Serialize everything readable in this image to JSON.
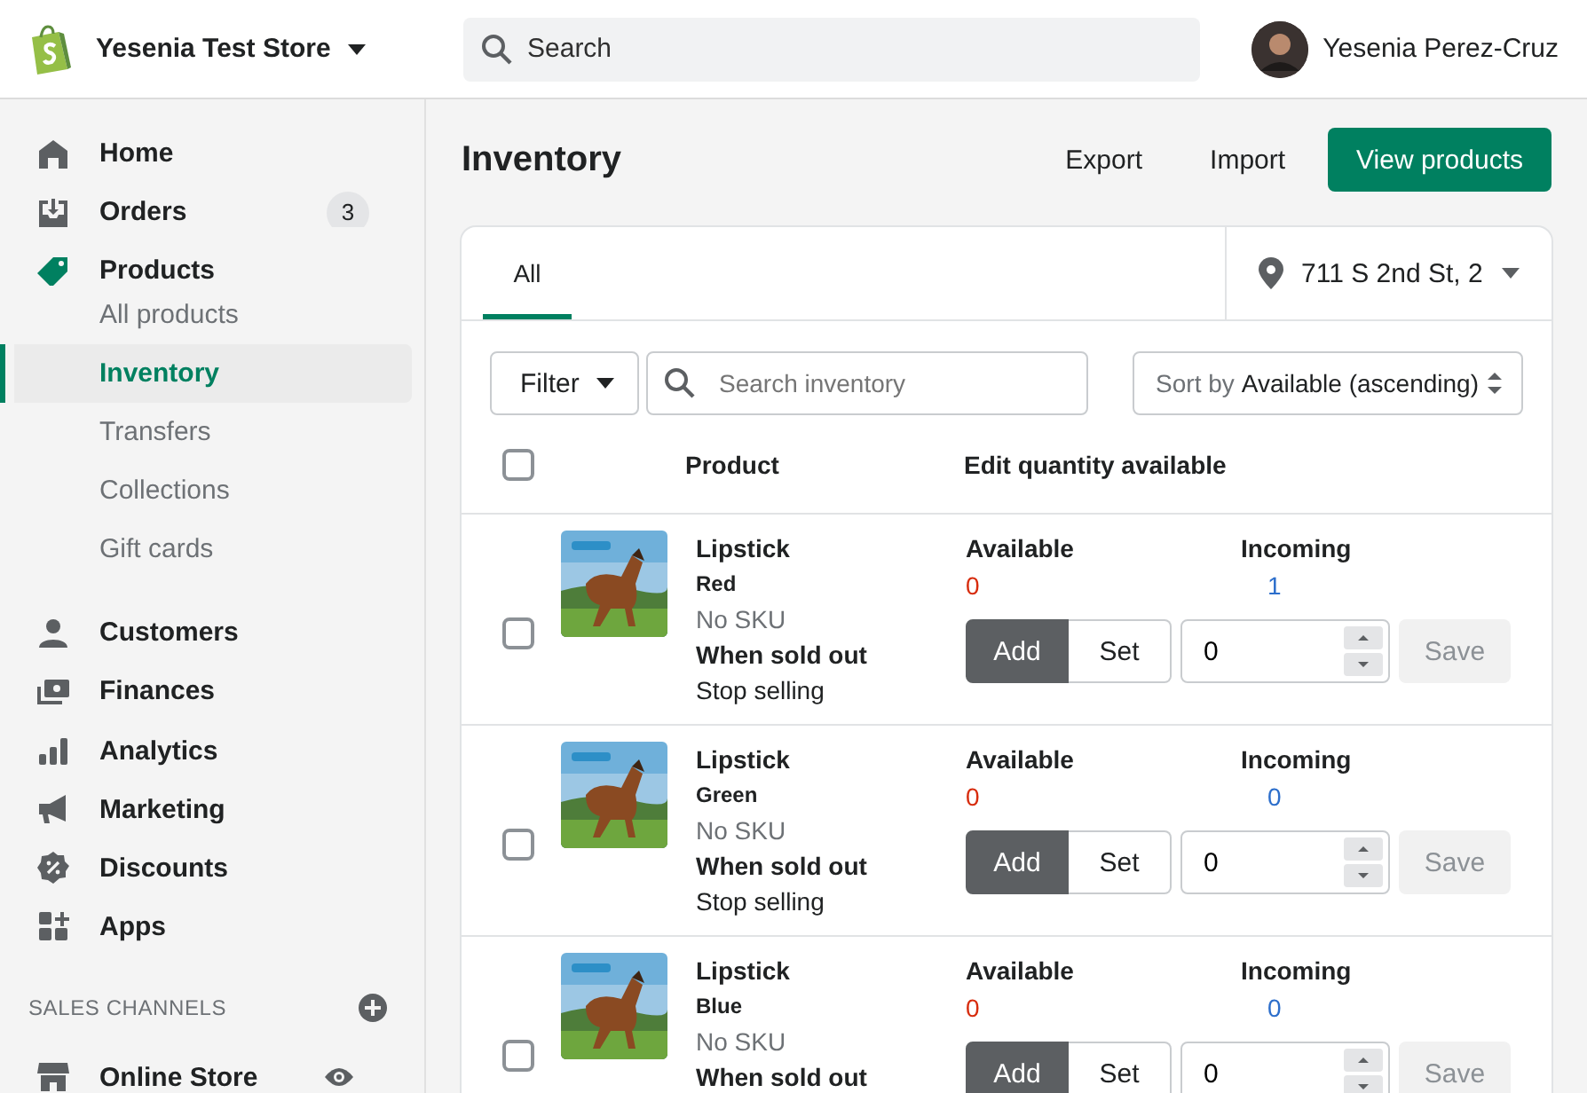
{
  "topbar": {
    "store_name": "Yesenia Test Store",
    "search": {
      "placeholder": "Search"
    },
    "user_name": "Yesenia Perez-Cruz"
  },
  "sidebar": {
    "items": [
      {
        "label": "Home",
        "kind": "main",
        "selected": false
      },
      {
        "label": "Orders",
        "kind": "main",
        "selected": false,
        "badge": "3"
      },
      {
        "label": "Products",
        "kind": "main",
        "selected": false
      },
      {
        "label": "All products",
        "kind": "sub",
        "selected": false
      },
      {
        "label": "Inventory",
        "kind": "sub",
        "selected": true
      },
      {
        "label": "Transfers",
        "kind": "sub",
        "selected": false
      },
      {
        "label": "Collections",
        "kind": "sub",
        "selected": false
      },
      {
        "label": "Gift cards",
        "kind": "sub",
        "selected": false
      },
      {
        "label": "Customers",
        "kind": "main",
        "selected": false
      },
      {
        "label": "Finances",
        "kind": "main",
        "selected": false
      },
      {
        "label": "Analytics",
        "kind": "main",
        "selected": false
      },
      {
        "label": "Marketing",
        "kind": "main",
        "selected": false
      },
      {
        "label": "Discounts",
        "kind": "main",
        "selected": false
      },
      {
        "label": "Apps",
        "kind": "main",
        "selected": false
      }
    ],
    "section_title": "SALES CHANNELS",
    "channels": [
      {
        "label": "Online Store",
        "selected": false
      }
    ]
  },
  "page": {
    "title": "Inventory",
    "actions": [
      "Export",
      "Import"
    ],
    "primary_action": "View products"
  },
  "card": {
    "tabs": [
      {
        "label": "All",
        "selected": true
      }
    ],
    "location": "711 S 2nd St, 2",
    "filter": "Filter",
    "search": {
      "placeholder": "Search inventory"
    },
    "sort": {
      "label": "Sort by",
      "value": "Available (ascending)"
    },
    "select_all": {
      "checked": false
    },
    "columns": [
      "Product",
      "Edit quantity available"
    ],
    "rows": [
      {
        "checked": false,
        "product": "Lipstick",
        "variant": "Red",
        "sku": "No SKU",
        "sold_out_label": "When sold out",
        "policy": "Stop selling",
        "available_label": "Available",
        "available": "0",
        "incoming_label": "Incoming",
        "incoming": "1",
        "modes": [
          {
            "label": "Add",
            "selected": true
          },
          {
            "label": "Set",
            "selected": false
          }
        ],
        "quantity": "0",
        "save": {
          "label": "Save",
          "disabled": true
        }
      },
      {
        "checked": false,
        "product": "Lipstick",
        "variant": "Green",
        "sku": "No SKU",
        "sold_out_label": "When sold out",
        "policy": "Stop selling",
        "available_label": "Available",
        "available": "0",
        "incoming_label": "Incoming",
        "incoming": "0",
        "modes": [
          {
            "label": "Add",
            "selected": true
          },
          {
            "label": "Set",
            "selected": false
          }
        ],
        "quantity": "0",
        "save": {
          "label": "Save",
          "disabled": true
        }
      },
      {
        "checked": false,
        "product": "Lipstick",
        "variant": "Blue",
        "sku": "No SKU",
        "sold_out_label": "When sold out",
        "available_label": "Available",
        "available": "0",
        "incoming_label": "Incoming",
        "incoming": "0",
        "modes": [
          {
            "label": "Add",
            "selected": true
          },
          {
            "label": "Set",
            "selected": false
          }
        ],
        "quantity": "0",
        "save": {
          "label": "Save",
          "disabled": true
        }
      }
    ]
  }
}
